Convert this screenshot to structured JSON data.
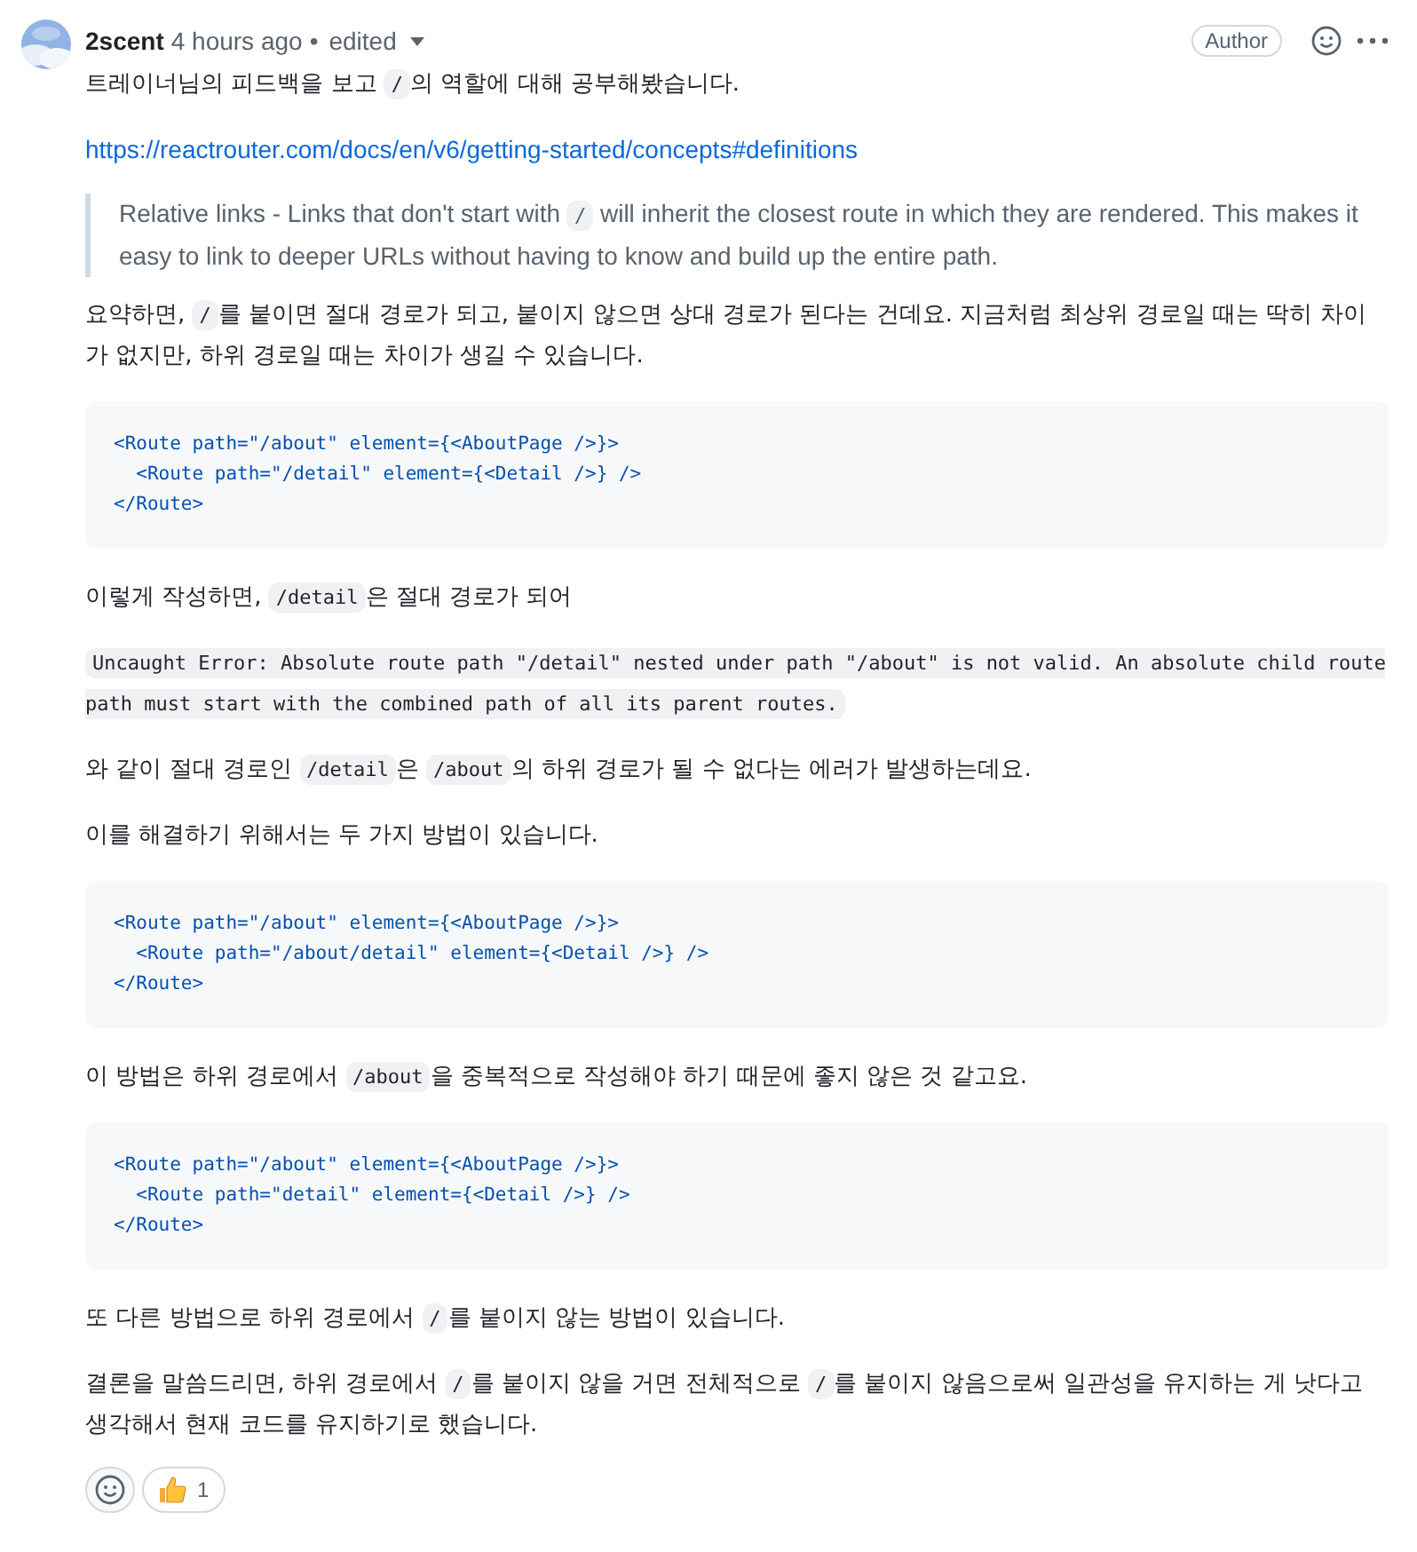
{
  "header": {
    "author": "2scent",
    "time": "4 hours ago",
    "separator": "•",
    "edited": "edited",
    "badge": "Author"
  },
  "blocks": [
    {
      "kind": "paragraph",
      "parts": [
        {
          "kind": "text",
          "text": "트레이너님의 피드백을 보고 "
        },
        {
          "kind": "code",
          "text": "/"
        },
        {
          "kind": "text",
          "text": "의 역할에 대해 공부해봤습니다."
        }
      ]
    },
    {
      "kind": "link",
      "text": "https://reactrouter.com/docs/en/v6/getting-started/concepts#definitions"
    },
    {
      "kind": "quote",
      "parts": [
        {
          "kind": "text",
          "text": "Relative links - Links that don't start with "
        },
        {
          "kind": "code",
          "text": "/"
        },
        {
          "kind": "text",
          "text": " will inherit the closest route in which they are rendered. This makes it easy to link to deeper URLs without having to know and build up the entire path."
        }
      ]
    },
    {
      "kind": "paragraph",
      "parts": [
        {
          "kind": "text",
          "text": "요약하면, "
        },
        {
          "kind": "code",
          "text": "/"
        },
        {
          "kind": "text",
          "text": "를 붙이면 절대 경로가 되고, 붙이지 않으면 상대 경로가 된다는 건데요. 지금처럼 최상위 경로일 때는 딱히 차이가 없지만, 하위 경로일 때는 차이가 생길 수 있습니다."
        }
      ]
    },
    {
      "kind": "code",
      "lines": [
        "<Route path=\"/about\" element={<AboutPage />}>",
        "  <Route path=\"/detail\" element={<Detail />} />",
        "</Route>"
      ]
    },
    {
      "kind": "paragraph",
      "parts": [
        {
          "kind": "text",
          "text": "이렇게 작성하면, "
        },
        {
          "kind": "code",
          "text": "/detail"
        },
        {
          "kind": "text",
          "text": "은 절대 경로가 되어"
        }
      ]
    },
    {
      "kind": "paragraph",
      "parts": [
        {
          "kind": "code",
          "text": "Uncaught Error: Absolute route path \"/detail\" nested under path \"/about\" is not valid. An absolute child route path must start with the combined path of all its parent routes."
        }
      ]
    },
    {
      "kind": "paragraph",
      "parts": [
        {
          "kind": "text",
          "text": "와 같이 절대 경로인 "
        },
        {
          "kind": "code",
          "text": "/detail"
        },
        {
          "kind": "text",
          "text": "은 "
        },
        {
          "kind": "code",
          "text": "/about"
        },
        {
          "kind": "text",
          "text": "의 하위 경로가 될 수 없다는 에러가 발생하는데요."
        }
      ]
    },
    {
      "kind": "paragraph",
      "parts": [
        {
          "kind": "text",
          "text": "이를 해결하기 위해서는 두 가지 방법이 있습니다."
        }
      ]
    },
    {
      "kind": "code",
      "lines": [
        "<Route path=\"/about\" element={<AboutPage />}>",
        "  <Route path=\"/about/detail\" element={<Detail />} />",
        "</Route>"
      ]
    },
    {
      "kind": "paragraph",
      "parts": [
        {
          "kind": "text",
          "text": "이 방법은 하위 경로에서 "
        },
        {
          "kind": "code",
          "text": "/about"
        },
        {
          "kind": "text",
          "text": "을 중복적으로 작성해야 하기 때문에 좋지 않은 것 같고요."
        }
      ]
    },
    {
      "kind": "code",
      "lines": [
        "<Route path=\"/about\" element={<AboutPage />}>",
        "  <Route path=\"detail\" element={<Detail />} />",
        "</Route>"
      ]
    },
    {
      "kind": "paragraph",
      "parts": [
        {
          "kind": "text",
          "text": "또 다른 방법으로 하위 경로에서 "
        },
        {
          "kind": "code",
          "text": "/"
        },
        {
          "kind": "text",
          "text": "를 붙이지 않는 방법이 있습니다."
        }
      ]
    },
    {
      "kind": "paragraph",
      "parts": [
        {
          "kind": "text",
          "text": "결론을 말씀드리면, 하위 경로에서 "
        },
        {
          "kind": "code",
          "text": "/"
        },
        {
          "kind": "text",
          "text": "를 붙이지 않을 거면 전체적으로 "
        },
        {
          "kind": "code",
          "text": "/"
        },
        {
          "kind": "text",
          "text": "를 붙이지 않음으로써 일관성을 유지하는 게 낫다고 생각해서 현재 코드를 유지하기로 했습니다."
        }
      ]
    }
  ],
  "reactions": [
    {
      "kind": "thumbs-up",
      "count": "1"
    }
  ]
}
